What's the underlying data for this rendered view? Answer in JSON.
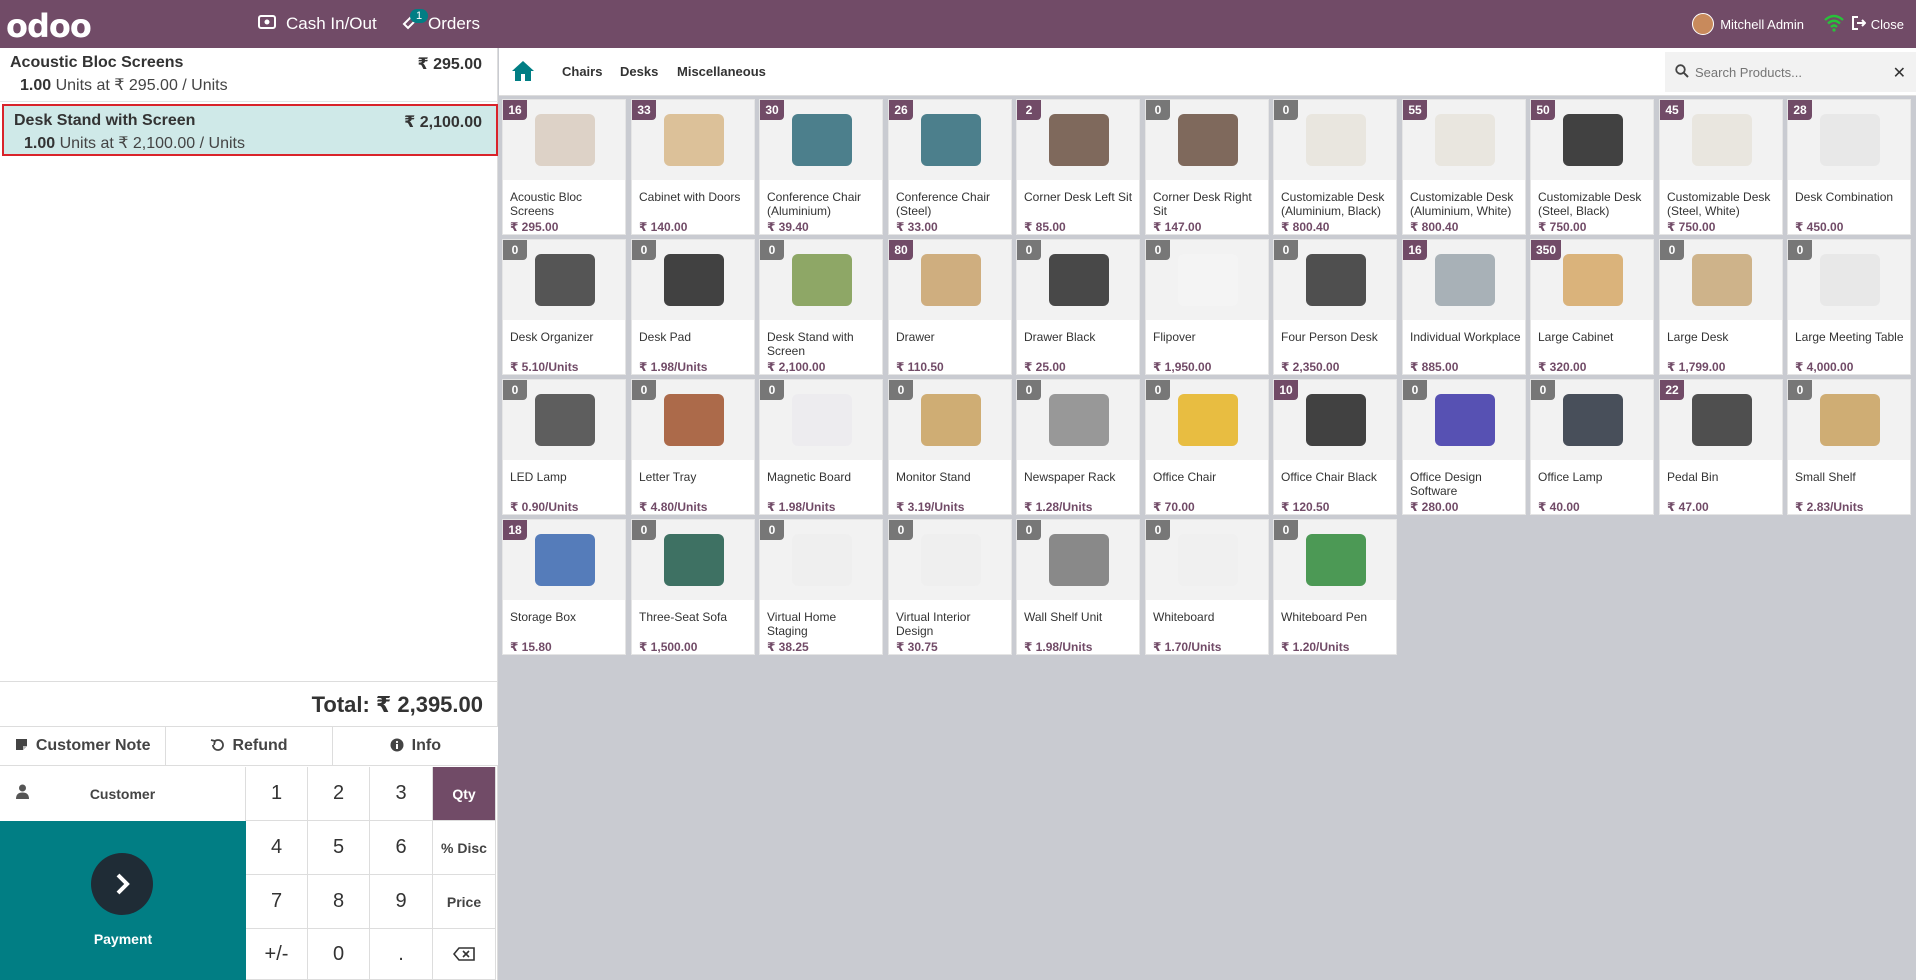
{
  "topbar": {
    "logo": "odoo",
    "cash_label": "Cash In/Out",
    "orders_label": "Orders",
    "orders_count": "1",
    "user": "Mitchell Admin",
    "close_label": "Close"
  },
  "order": {
    "lines": [
      {
        "name": "Acoustic Bloc Screens",
        "price": "₹ 295.00",
        "qty": "1.00",
        "info": " Units at ₹ 295.00 / Units"
      },
      {
        "name": "Desk Stand with Screen",
        "price": "₹ 2,100.00",
        "qty": "1.00",
        "info": " Units at ₹ 2,100.00 / Units"
      }
    ],
    "total": "Total: ₹ 2,395.00"
  },
  "controls": {
    "customer_note": "Customer Note",
    "refund": "Refund",
    "info": "Info",
    "customer": "Customer",
    "payment": "Payment"
  },
  "numpad": [
    "1",
    "2",
    "3",
    "Qty",
    "4",
    "5",
    "6",
    "% Disc",
    "7",
    "8",
    "9",
    "Price",
    "+/-",
    "0",
    "."
  ],
  "categories": [
    "Chairs",
    "Desks",
    "Miscellaneous"
  ],
  "search": {
    "placeholder": "Search Products..."
  },
  "products": [
    {
      "name": "Acoustic Bloc Screens",
      "price": "₹ 295.00",
      "stock": "16",
      "color": "#d9cdbf"
    },
    {
      "name": "Cabinet with Doors",
      "price": "₹ 140.00",
      "stock": "33",
      "color": "#d8b98a"
    },
    {
      "name": "Conference Chair (Aluminium)",
      "price": "₹ 39.40",
      "stock": "30",
      "color": "#2f6b7a"
    },
    {
      "name": "Conference Chair (Steel)",
      "price": "₹ 33.00",
      "stock": "26",
      "color": "#2f6b7a"
    },
    {
      "name": "Corner Desk Left Sit",
      "price": "₹ 85.00",
      "stock": "2",
      "color": "#6b5142"
    },
    {
      "name": "Corner Desk Right Sit",
      "price": "₹ 147.00",
      "stock": "0",
      "color": "#6b5142"
    },
    {
      "name": "Customizable Desk (Aluminium, Black)",
      "price": "₹ 800.40",
      "stock": "0",
      "color": "#e8e4dc"
    },
    {
      "name": "Customizable Desk (Aluminium, White)",
      "price": "₹ 800.40",
      "stock": "55",
      "color": "#e8e4dc"
    },
    {
      "name": "Customizable Desk (Steel, Black)",
      "price": "₹ 750.00",
      "stock": "50",
      "color": "#222222"
    },
    {
      "name": "Customizable Desk (Steel, White)",
      "price": "₹ 750.00",
      "stock": "45",
      "color": "#e8e4dc"
    },
    {
      "name": "Desk Combination",
      "price": "₹ 450.00",
      "stock": "28",
      "color": "#e6e6e6"
    },
    {
      "name": "Desk Organizer",
      "price": "₹ 5.10/Units",
      "stock": "0",
      "color": "#3a3a3a"
    },
    {
      "name": "Desk Pad",
      "price": "₹ 1.98/Units",
      "stock": "0",
      "color": "#222222"
    },
    {
      "name": "Desk Stand with Screen",
      "price": "₹ 2,100.00",
      "stock": "0",
      "color": "#7c9a4e"
    },
    {
      "name": "Drawer",
      "price": "₹ 110.50",
      "stock": "80",
      "color": "#c9a26b"
    },
    {
      "name": "Drawer Black",
      "price": "₹ 25.00",
      "stock": "0",
      "color": "#2a2a2a"
    },
    {
      "name": "Flipover",
      "price": "₹ 1,950.00",
      "stock": "0",
      "color": "#f4f4f4"
    },
    {
      "name": "Four Person Desk",
      "price": "₹ 2,350.00",
      "stock": "0",
      "color": "#333333"
    },
    {
      "name": "Individual Workplace",
      "price": "₹ 885.00",
      "stock": "16",
      "color": "#9ba6ad"
    },
    {
      "name": "Large Cabinet",
      "price": "₹ 320.00",
      "stock": "350",
      "color": "#d6a866"
    },
    {
      "name": "Large Desk",
      "price": "₹ 1,799.00",
      "stock": "0",
      "color": "#c8a878"
    },
    {
      "name": "Large Meeting Table",
      "price": "₹ 4,000.00",
      "stock": "0",
      "color": "#e6e6e6"
    },
    {
      "name": "LED Lamp",
      "price": "₹ 0.90/Units",
      "stock": "0",
      "color": "#444444"
    },
    {
      "name": "Letter Tray",
      "price": "₹ 4.80/Units",
      "stock": "0",
      "color": "#a0522d"
    },
    {
      "name": "Magnetic Board",
      "price": "₹ 1.98/Units",
      "stock": "0",
      "color": "#ecebee"
    },
    {
      "name": "Monitor Stand",
      "price": "₹ 3.19/Units",
      "stock": "0",
      "color": "#c9a15e"
    },
    {
      "name": "Newspaper Rack",
      "price": "₹ 1.28/Units",
      "stock": "0",
      "color": "#888888"
    },
    {
      "name": "Office Chair",
      "price": "₹ 70.00",
      "stock": "0",
      "color": "#e6b422"
    },
    {
      "name": "Office Chair Black",
      "price": "₹ 120.50",
      "stock": "10",
      "color": "#222222"
    },
    {
      "name": "Office Design Software",
      "price": "₹ 280.00",
      "stock": "0",
      "color": "#3c35a8"
    },
    {
      "name": "Office Lamp",
      "price": "₹ 40.00",
      "stock": "0",
      "color": "#2a3340"
    },
    {
      "name": "Pedal Bin",
      "price": "₹ 47.00",
      "stock": "22",
      "color": "#333333"
    },
    {
      "name": "Small Shelf",
      "price": "₹ 2.83/Units",
      "stock": "0",
      "color": "#c9a15e"
    },
    {
      "name": "Storage Box",
      "price": "₹ 15.80",
      "stock": "18",
      "color": "#3a67b0"
    },
    {
      "name": "Three-Seat Sofa",
      "price": "₹ 1,500.00",
      "stock": "0",
      "color": "#1f5a4a"
    },
    {
      "name": "Virtual Home Staging",
      "price": "₹ 38.25",
      "stock": "0",
      "color": "#eeeeee"
    },
    {
      "name": "Virtual Interior Design",
      "price": "₹ 30.75",
      "stock": "0",
      "color": "#eeeeee"
    },
    {
      "name": "Wall Shelf Unit",
      "price": "₹ 1.98/Units",
      "stock": "0",
      "color": "#777777"
    },
    {
      "name": "Whiteboard",
      "price": "₹ 1.70/Units",
      "stock": "0",
      "color": "#f0f0f0"
    },
    {
      "name": "Whiteboard Pen",
      "price": "₹ 1.20/Units",
      "stock": "0",
      "color": "#2f8a3a"
    }
  ],
  "colors": {
    "primary": "#714b67",
    "teal": "#017e84",
    "selected_line": "#cfe9e8",
    "selected_border": "#d9232a"
  }
}
